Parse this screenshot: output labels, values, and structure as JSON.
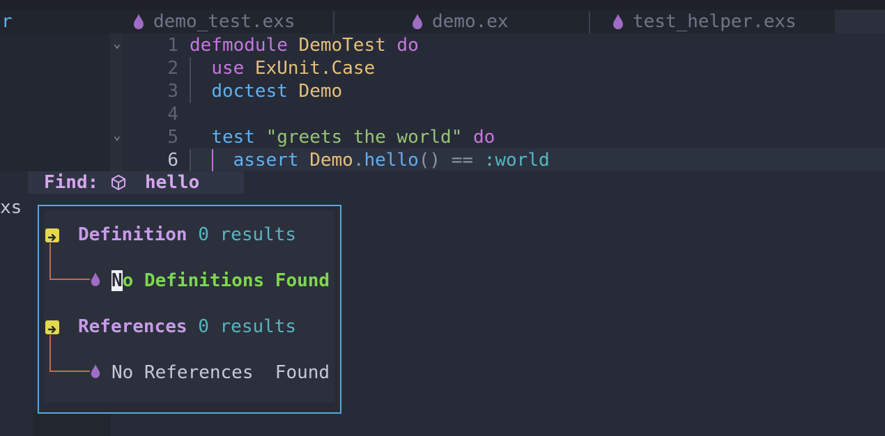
{
  "tabs": [
    {
      "label": "demo_test.exs"
    },
    {
      "label": "demo.ex"
    },
    {
      "label": "test_helper.exs"
    }
  ],
  "sidebar": {
    "fragment_top": "r",
    "fragment_mid": "xs"
  },
  "editor": {
    "line_numbers": [
      "1",
      "2",
      "3",
      "4",
      "5",
      "6"
    ],
    "lines": {
      "l1": {
        "a": "defmodule",
        "b": " DemoTest",
        "c": " do"
      },
      "l2": {
        "a": "use",
        "b": " ExUnit.Case"
      },
      "l3": {
        "a": "doctest",
        "b": " Demo"
      },
      "l5": {
        "a": "test",
        "b": " \"greets the world\"",
        "c": " do"
      },
      "l6": {
        "a": "assert",
        "b": " Demo",
        "c": ".",
        "d": "hello",
        "e": "()",
        "f": " == ",
        "g": ":world"
      }
    }
  },
  "find": {
    "label": "Find:",
    "query": "hello",
    "icon": "cube-icon"
  },
  "results": {
    "definition": {
      "title": "Definition",
      "count": "0 results",
      "empty_first": "N",
      "empty_rest": "o Definitions Found"
    },
    "references": {
      "title": "References",
      "count": "0 results",
      "empty": "No References  Found"
    }
  },
  "colors": {
    "accent": "#56a9dc",
    "purple": "#c678dd",
    "green": "#7ed84f"
  }
}
